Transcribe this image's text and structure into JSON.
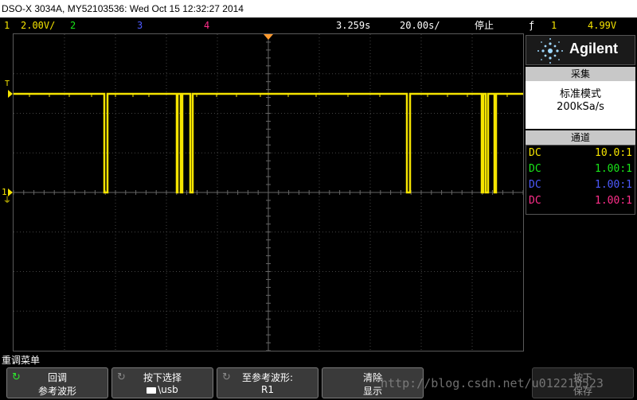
{
  "title": "DSO-X 3034A, MY52103536: Wed Oct 15 12:32:27 2014",
  "status_bar": {
    "ch1_num": "1",
    "ch1_scale": "2.00V/",
    "ch2_num": "2",
    "ch3_num": "3",
    "ch4_num": "4",
    "time_delay": "3.259s",
    "time_scale": "20.00s/",
    "run_state": "停止",
    "trigger_icon": "ƒ",
    "trigger_src": "1",
    "trigger_level": "4.99V"
  },
  "markers": {
    "trigger_level_label": "T",
    "ch1_ground_label": "1"
  },
  "side_panel": {
    "brand": "Agilent",
    "acquire": {
      "header": "采集",
      "mode": "标准模式",
      "rate": "200kSa/s"
    },
    "channels": {
      "header": "通道",
      "rows": [
        {
          "coupling": "DC",
          "probe": "10.0:1",
          "color": "#f5e400"
        },
        {
          "coupling": "DC",
          "probe": "1.00:1",
          "color": "#19e619"
        },
        {
          "coupling": "DC",
          "probe": "1.00:1",
          "color": "#4d5aff"
        },
        {
          "coupling": "DC",
          "probe": "1.00:1",
          "color": "#ff2e8a"
        }
      ]
    }
  },
  "softkeys": {
    "menu_title": "重调菜单",
    "keys": [
      {
        "line1": "回调",
        "line2": "参考波形"
      },
      {
        "line1": "按下选择",
        "line2": "\\usb"
      },
      {
        "line1": "至参考波形:",
        "line2": "R1"
      },
      {
        "line1": "清除",
        "line2": "显示"
      },
      {
        "line1": "按下",
        "line2": "保存"
      }
    ]
  },
  "watermark": "http://blog.csdn.net/u012210523",
  "colors": {
    "ch1": "#f5e400",
    "ch2": "#19e619",
    "ch3": "#4d5aff",
    "ch4": "#ff2e8a",
    "trigger_marker": "#ff9a2e"
  }
}
